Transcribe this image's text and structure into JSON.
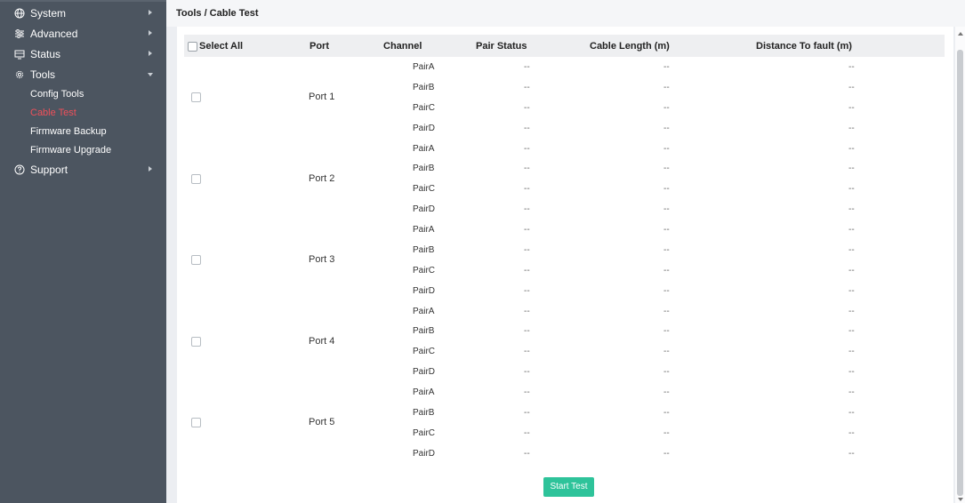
{
  "sidebar": {
    "menu": [
      {
        "label": "System",
        "icon": "globe-icon",
        "expanded": false
      },
      {
        "label": "Advanced",
        "icon": "sliders-icon",
        "expanded": false
      },
      {
        "label": "Status",
        "icon": "monitor-icon",
        "expanded": false
      },
      {
        "label": "Tools",
        "icon": "gear-icon",
        "expanded": true
      },
      {
        "label": "Support",
        "icon": "help-circle-icon",
        "expanded": false
      }
    ],
    "tools_submenu": [
      {
        "label": "Config Tools",
        "active": false
      },
      {
        "label": "Cable Test",
        "active": true
      },
      {
        "label": "Firmware Backup",
        "active": false
      },
      {
        "label": "Firmware Upgrade",
        "active": false
      }
    ],
    "active_color": "#f0505a",
    "background": "#4c5560"
  },
  "breadcrumb": "Tools / Cable Test",
  "table": {
    "select_all_label": "Select All",
    "headers": {
      "port": "Port",
      "channel": "Channel",
      "pair_status": "Pair Status",
      "cable_length": "Cable Length (m)",
      "distance_to_fault": "Distance To fault (m)"
    },
    "ports": [
      {
        "label": "Port 1",
        "pairs": [
          {
            "channel": "PairA",
            "status": "--",
            "length": "--",
            "fault": "--"
          },
          {
            "channel": "PairB",
            "status": "--",
            "length": "--",
            "fault": "--"
          },
          {
            "channel": "PairC",
            "status": "--",
            "length": "--",
            "fault": "--"
          },
          {
            "channel": "PairD",
            "status": "--",
            "length": "--",
            "fault": "--"
          }
        ]
      },
      {
        "label": "Port 2",
        "pairs": [
          {
            "channel": "PairA",
            "status": "--",
            "length": "--",
            "fault": "--"
          },
          {
            "channel": "PairB",
            "status": "--",
            "length": "--",
            "fault": "--"
          },
          {
            "channel": "PairC",
            "status": "--",
            "length": "--",
            "fault": "--"
          },
          {
            "channel": "PairD",
            "status": "--",
            "length": "--",
            "fault": "--"
          }
        ]
      },
      {
        "label": "Port 3",
        "pairs": [
          {
            "channel": "PairA",
            "status": "--",
            "length": "--",
            "fault": "--"
          },
          {
            "channel": "PairB",
            "status": "--",
            "length": "--",
            "fault": "--"
          },
          {
            "channel": "PairC",
            "status": "--",
            "length": "--",
            "fault": "--"
          },
          {
            "channel": "PairD",
            "status": "--",
            "length": "--",
            "fault": "--"
          }
        ]
      },
      {
        "label": "Port 4",
        "pairs": [
          {
            "channel": "PairA",
            "status": "--",
            "length": "--",
            "fault": "--"
          },
          {
            "channel": "PairB",
            "status": "--",
            "length": "--",
            "fault": "--"
          },
          {
            "channel": "PairC",
            "status": "--",
            "length": "--",
            "fault": "--"
          },
          {
            "channel": "PairD",
            "status": "--",
            "length": "--",
            "fault": "--"
          }
        ]
      },
      {
        "label": "Port 5",
        "pairs": [
          {
            "channel": "PairA",
            "status": "--",
            "length": "--",
            "fault": "--"
          },
          {
            "channel": "PairB",
            "status": "--",
            "length": "--",
            "fault": "--"
          },
          {
            "channel": "PairC",
            "status": "--",
            "length": "--",
            "fault": "--"
          },
          {
            "channel": "PairD",
            "status": "--",
            "length": "--",
            "fault": "--"
          }
        ]
      }
    ]
  },
  "start_button_label": "Start Test",
  "start_button_color": "#2ec39a"
}
